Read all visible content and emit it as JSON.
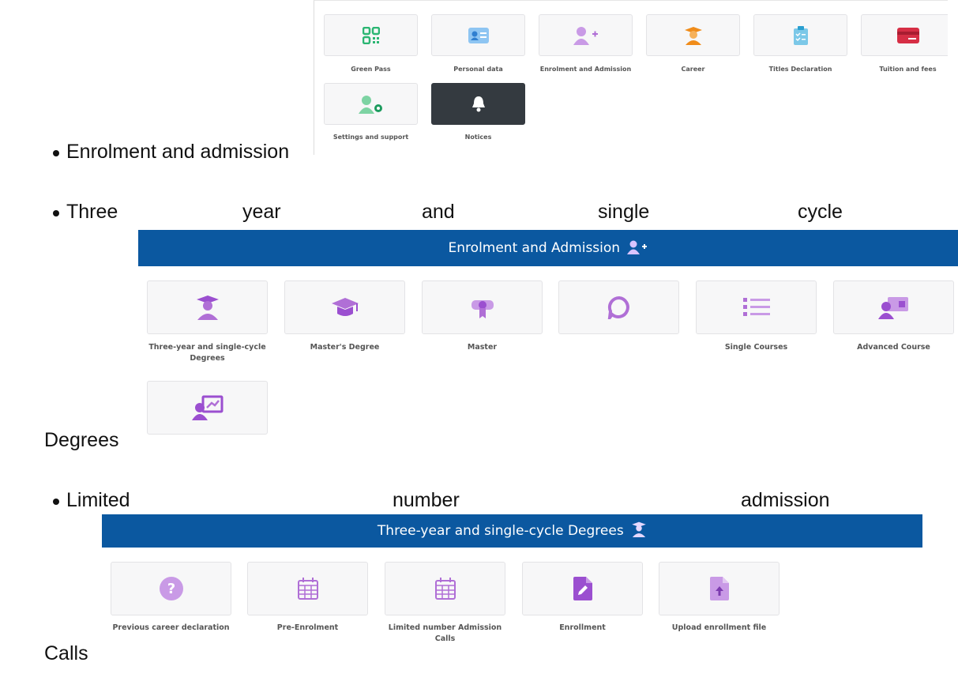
{
  "doc": {
    "item1": "Enrolment and admission",
    "item2_words": [
      "Three",
      "year",
      "and",
      "single",
      "cycle"
    ],
    "item2_tail": "Degrees",
    "item3_words": [
      "Limited",
      "number",
      "admission"
    ],
    "item3_tail": "Calls"
  },
  "menu_main": {
    "tiles": [
      {
        "label": "Green Pass",
        "icon": "qr-code-icon"
      },
      {
        "label": "Personal data",
        "icon": "id-card-icon"
      },
      {
        "label": "Enrolment and Admission",
        "icon": "user-plus-icon"
      },
      {
        "label": "Career",
        "icon": "graduate-icon"
      },
      {
        "label": "Titles Declaration",
        "icon": "clipboard-check-icon"
      },
      {
        "label": "Tuition and fees",
        "icon": "credit-card-icon"
      },
      {
        "label": "Settings and support",
        "icon": "user-gear-icon"
      },
      {
        "label": "Notices",
        "icon": "bell-icon"
      }
    ]
  },
  "menu_enrolment": {
    "title": "Enrolment and Admission",
    "tiles": [
      {
        "label": "Three-year and single-cycle Degrees",
        "icon": "graduate-icon"
      },
      {
        "label": "Master's Degree",
        "icon": "mortarboard-icon"
      },
      {
        "label": "Master",
        "icon": "diploma-icon"
      },
      {
        "label": "",
        "icon": "chat-bubble-icon"
      },
      {
        "label": "Single Courses",
        "icon": "list-icon"
      },
      {
        "label": "Advanced Course",
        "icon": "teacher-board-icon"
      },
      {
        "label": "",
        "icon": "presentation-chart-icon"
      }
    ]
  },
  "menu_degrees": {
    "title": "Three-year and single-cycle Degrees",
    "tiles": [
      {
        "label": "Previous career declaration",
        "icon": "question-icon"
      },
      {
        "label": "Pre-Enrolment",
        "icon": "calendar-icon"
      },
      {
        "label": "Limited number Admission Calls",
        "icon": "calendar-icon"
      },
      {
        "label": "Enrollment",
        "icon": "file-edit-icon"
      },
      {
        "label": "Upload enrollment file",
        "icon": "file-upload-icon"
      }
    ]
  },
  "colors": {
    "banner": "#0b58a0",
    "purple": "#b06fd6",
    "green": "#2bb673",
    "orange": "#f08c1a",
    "red": "#d62e45",
    "blue": "#5aa7e8"
  }
}
